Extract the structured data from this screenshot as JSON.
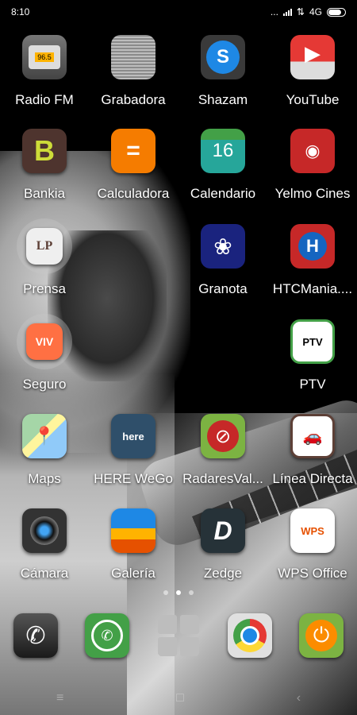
{
  "status": {
    "time": "8:10",
    "dots": "...",
    "network": "4G",
    "battery_level": 0.9
  },
  "apps": [
    {
      "label": "Radio FM",
      "icon": "radio-icon",
      "glyph": "96.5",
      "bg": "#5a5a5a"
    },
    {
      "label": "Grabadora",
      "icon": "microphone-icon",
      "glyph": "",
      "bg": "#8a8a8a"
    },
    {
      "label": "Shazam",
      "icon": "shazam-icon",
      "glyph": "S",
      "bg": "#1e88e5"
    },
    {
      "label": "YouTube",
      "icon": "youtube-icon",
      "glyph": "▶",
      "bg": "#e53935"
    },
    {
      "label": "Bankia",
      "icon": "bankia-icon",
      "glyph": "B",
      "bg": "#4e342e"
    },
    {
      "label": "Calculadora",
      "icon": "calculator-icon",
      "glyph": "=",
      "bg": "#f57c00"
    },
    {
      "label": "Calendario",
      "icon": "calendar-icon",
      "glyph": "16",
      "bg": "#26a69a"
    },
    {
      "label": "Yelmo Cines",
      "icon": "yelmo-cines-icon",
      "glyph": "◉",
      "bg": "#c62828"
    },
    {
      "label": "Prensa",
      "icon": "folder-icon",
      "glyph": "LP",
      "bg": "#efefef"
    },
    {
      "label": "Granota",
      "icon": "frog-icon",
      "glyph": "❀",
      "bg": "#1a237e"
    },
    {
      "label": "HTCMania....",
      "icon": "htcmania-icon",
      "glyph": "H",
      "bg": "#c62828"
    },
    {
      "label": "Seguro",
      "icon": "folder-icon",
      "glyph": "VIV",
      "bg": "#ff7043"
    },
    {
      "label": "PTV",
      "icon": "ptv-telecom-icon",
      "glyph": "PTV",
      "bg": "#ffffff"
    },
    {
      "label": "Maps",
      "icon": "maps-icon",
      "glyph": "📍",
      "bg": "#e8f5e9"
    },
    {
      "label": "HERE WeGo",
      "icon": "here-wego-icon",
      "glyph": "here",
      "bg": "#2f4f6a"
    },
    {
      "label": "RadaresVal...",
      "icon": "radar-icon",
      "glyph": "⊘",
      "bg": "#c62828"
    },
    {
      "label": "Línea Directa",
      "icon": "linea-directa-icon",
      "glyph": "🚗",
      "bg": "#ffffff"
    },
    {
      "label": "Cámara",
      "icon": "camera-icon",
      "glyph": "◎",
      "bg": "#333333"
    },
    {
      "label": "Galería",
      "icon": "gallery-icon",
      "glyph": "▬",
      "bg": "#f9a825"
    },
    {
      "label": "Zedge",
      "icon": "zedge-icon",
      "glyph": "D",
      "bg": "#263238"
    },
    {
      "label": "WPS Office",
      "icon": "wps-office-icon",
      "glyph": "WPS",
      "bg": "#ffffff"
    }
  ],
  "dock": [
    {
      "icon": "phone-icon",
      "glyph": "✆",
      "bg": "#2a2a2a"
    },
    {
      "icon": "whatsapp-icon",
      "glyph": "✆",
      "bg": "#43a047"
    },
    {
      "icon": "apps-drawer-icon",
      "glyph": "",
      "bg": "#9e9e9e"
    },
    {
      "icon": "chrome-icon",
      "glyph": "",
      "bg": "#e0e0e0"
    },
    {
      "icon": "power-icon",
      "glyph": "⏻",
      "bg": "#7cb342"
    }
  ],
  "navigation": {
    "menu": "≡",
    "home": "□",
    "back": "‹"
  },
  "colors": {
    "text": "#ffffff",
    "background": "#000000"
  }
}
